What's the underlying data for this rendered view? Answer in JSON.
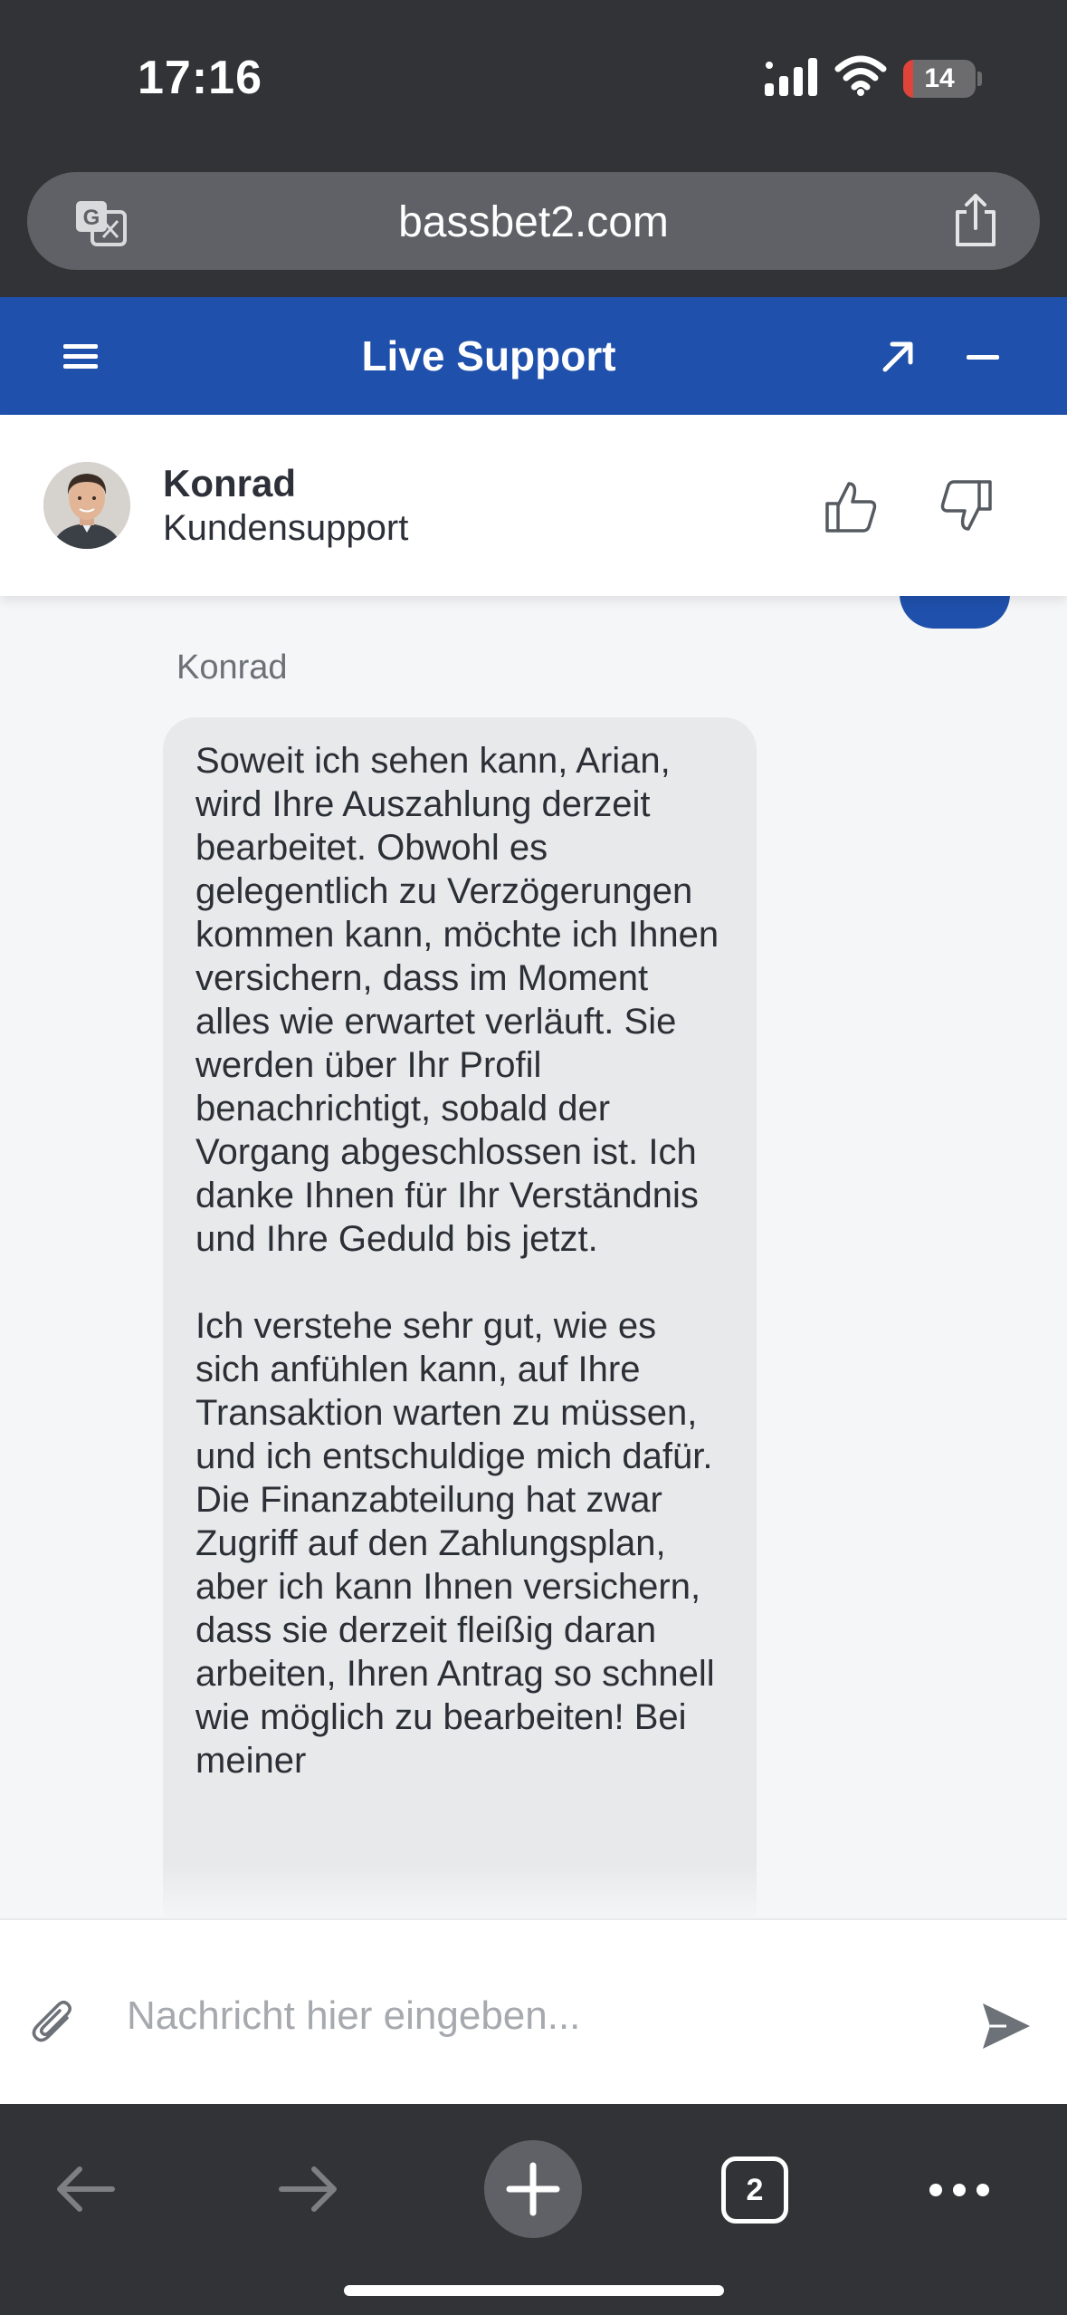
{
  "status_bar": {
    "time": "17:16",
    "battery_level": "14",
    "battery_fraction": 0.14
  },
  "browser": {
    "url": "bassbet2.com",
    "open_tabs": "2"
  },
  "support_header": {
    "title": "Live Support"
  },
  "agent": {
    "name": "Konrad",
    "role": "Kundensupport"
  },
  "chat": {
    "messages": [
      {
        "sender": "Konrad",
        "paragraphs": [
          "Soweit ich sehen kann, Arian, wird Ihre Auszahlung derzeit bearbeitet. Obwohl es gelegentlich zu Verzögerungen kommen kann, möchte ich Ihnen versichern, dass im Moment alles wie erwartet verläuft. Sie werden über Ihr Profil benachrichtigt, sobald der Vorgang abgeschlossen ist. Ich danke Ihnen für Ihr Verständnis und Ihre Geduld bis jetzt.",
          "Ich verstehe sehr gut, wie es sich anfühlen kann, auf Ihre Transaktion warten zu müssen, und ich entschuldige mich dafür. Die Finanzabteilung hat zwar Zugriff auf den Zahlungsplan, aber ich kann Ihnen versichern, dass sie derzeit fleißig daran arbeiten, Ihren Antrag so schnell wie möglich zu bearbeiten! Bei meiner"
        ]
      }
    ]
  },
  "composer": {
    "placeholder": "Nachricht hier eingeben..."
  },
  "colors": {
    "header_blue": "#1f50ab",
    "chrome_dark": "#313336",
    "bubble_gray": "#e8e9eb",
    "battery_red": "#e0433a"
  },
  "icons": [
    "translate-icon",
    "share-icon",
    "menu-icon",
    "expand-icon",
    "minimize-icon",
    "thumbs-up-icon",
    "thumbs-down-icon",
    "attach-icon",
    "send-icon",
    "back-icon",
    "forward-icon",
    "plus-icon",
    "more-icon"
  ]
}
